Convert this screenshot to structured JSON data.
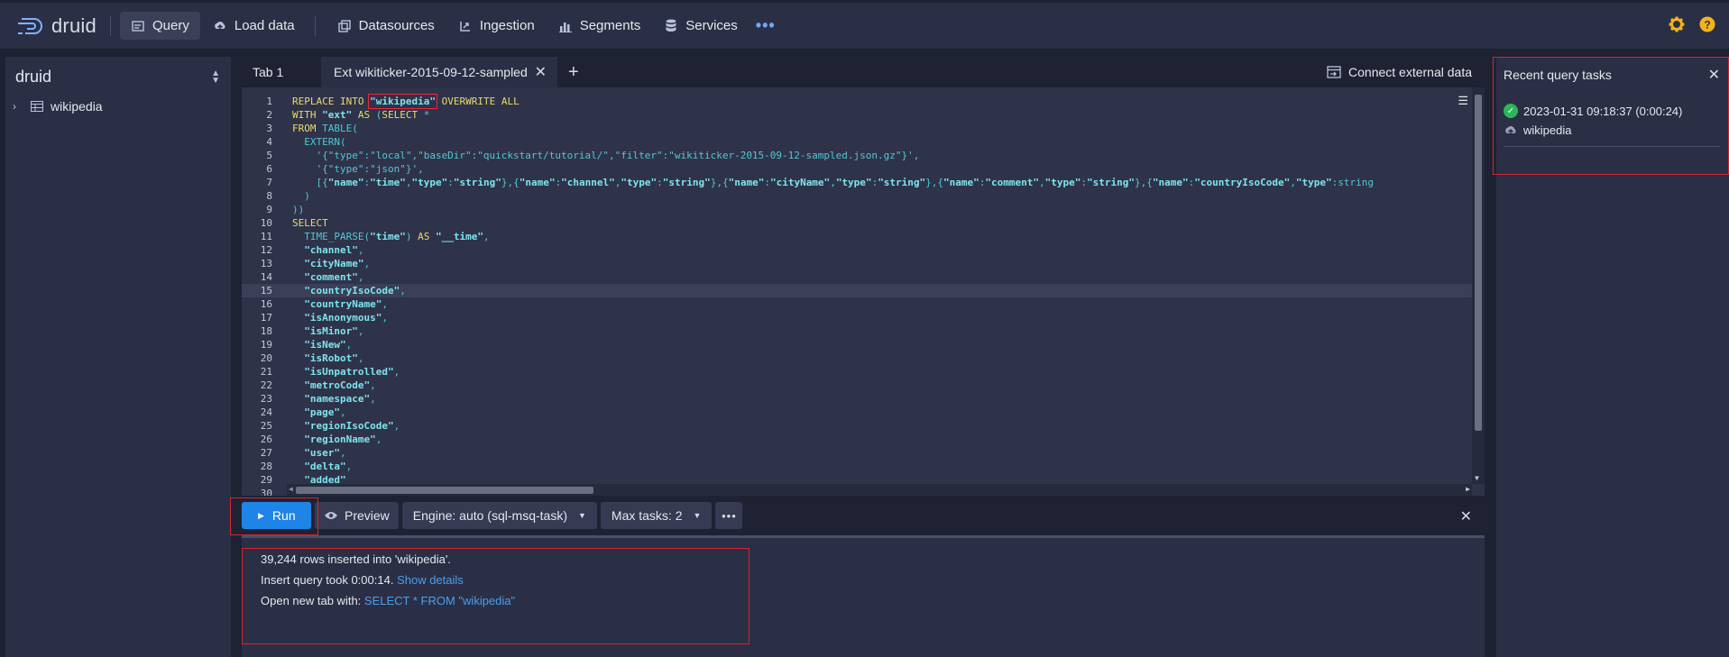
{
  "app": {
    "name": "druid"
  },
  "nav": {
    "items": [
      {
        "label": "Query",
        "icon": "query-icon",
        "active": true
      },
      {
        "label": "Load data",
        "icon": "cloud-upload-icon"
      },
      {
        "label": "Datasources",
        "icon": "datasources-icon"
      },
      {
        "label": "Ingestion",
        "icon": "ingestion-icon"
      },
      {
        "label": "Segments",
        "icon": "segments-icon"
      },
      {
        "label": "Services",
        "icon": "database-icon"
      }
    ],
    "more": "•••"
  },
  "sidebar": {
    "title": "druid",
    "tree": [
      {
        "label": "wikipedia",
        "icon": "table-icon"
      }
    ]
  },
  "tabs": [
    {
      "label": "Tab 1"
    },
    {
      "label": "Ext wikiticker-2015-09-12-sampled",
      "active": true
    }
  ],
  "connect_external": "Connect external data",
  "editor": {
    "lines": [
      "REPLACE INTO \"wikipedia\" OVERWRITE ALL",
      "WITH \"ext\" AS (SELECT *",
      "FROM TABLE(",
      "  EXTERN(",
      "    '{\"type\":\"local\",\"baseDir\":\"quickstart/tutorial/\",\"filter\":\"wikiticker-2015-09-12-sampled.json.gz\"}',",
      "    '{\"type\":\"json\"}',",
      "    '[{\"name\":\"time\",\"type\":\"string\"},{\"name\":\"channel\",\"type\":\"string\"},{\"name\":\"cityName\",\"type\":\"string\"},{\"name\":\"comment\",\"type\":\"string\"},{\"name\":\"countryIsoCode\",\"type\":\"string",
      "  )",
      "))",
      "SELECT",
      "  TIME_PARSE(\"time\") AS \"__time\",",
      "  \"channel\",",
      "  \"cityName\",",
      "  \"comment\",",
      "  \"countryIsoCode\",",
      "  \"countryName\",",
      "  \"isAnonymous\",",
      "  \"isMinor\",",
      "  \"isNew\",",
      "  \"isRobot\",",
      "  \"isUnpatrolled\",",
      "  \"metroCode\",",
      "  \"namespace\",",
      "  \"page\",",
      "  \"regionIsoCode\",",
      "  \"regionName\",",
      "  \"user\",",
      "  \"delta\",",
      "  \"added\"",
      ""
    ],
    "highlight_line": 15
  },
  "runbar": {
    "run": "Run",
    "preview": "Preview",
    "engine": "Engine: auto (sql-msq-task)",
    "max_tasks": "Max tasks: 2",
    "more": "•••"
  },
  "results": {
    "line1": "39,244 rows inserted into 'wikipedia'.",
    "line2_prefix": "Insert query took 0:00:14.",
    "line2_link": "Show details",
    "line3_prefix": "Open new tab with:",
    "line3_link": "SELECT * FROM \"wikipedia\""
  },
  "recent_tasks": {
    "title": "Recent query tasks",
    "items": [
      {
        "time": "2023-01-31 09:18:37 (0:00:24)",
        "datasource": "wikipedia",
        "status": "success"
      }
    ]
  },
  "colors": {
    "accent": "#1f84e8",
    "annotation": "#d9232f",
    "success": "#2cb55a",
    "settings": "#f2b31b"
  }
}
